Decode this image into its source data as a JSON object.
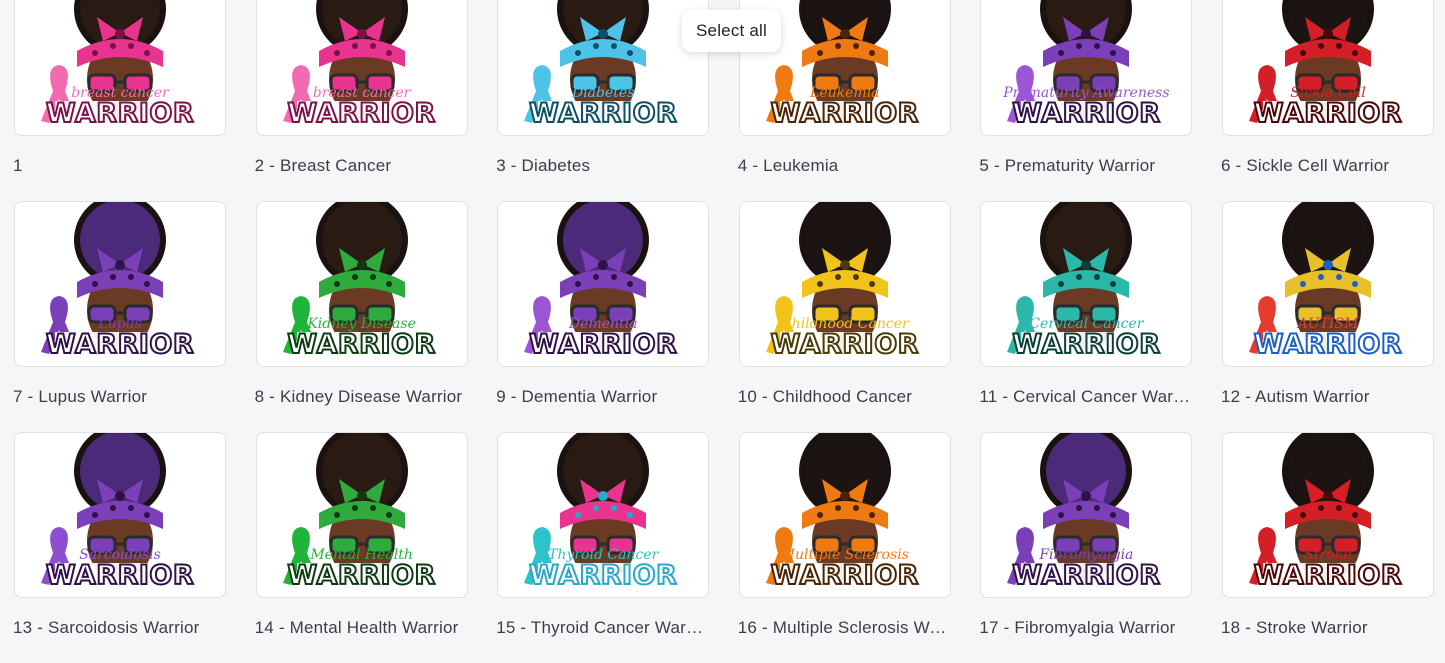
{
  "tooltip": {
    "label": "Select all"
  },
  "items": [
    {
      "caption": "1",
      "scarf": "#e8338f",
      "pattern": "#7a1147",
      "hair": "#2a1a14",
      "ribbon": "#f26bb0",
      "text": "breast cancer",
      "warrior": "WARRIOR",
      "glasses": "#2b2b2b"
    },
    {
      "caption": "2 - Breast Cancer",
      "scarf": "#e8338f",
      "pattern": "#7a1147",
      "hair": "#2a1a14",
      "ribbon": "#f26bb0",
      "text": "breast cancer",
      "warrior": "WARRIOR",
      "glasses": "#2b2b2b"
    },
    {
      "caption": "3 - Diabetes",
      "scarf": "#4ec3e8",
      "pattern": "#0d4f66",
      "hair": "#2a1a14",
      "ribbon": "#4ec3e8",
      "text": "Diabetes",
      "warrior": "WARRIOR",
      "glasses": "#2b2b2b"
    },
    {
      "caption": "4 - Leukemia",
      "scarf": "#f07a12",
      "pattern": "#4a2305",
      "hair": "#1b1412",
      "ribbon": "#f07a12",
      "text": "Leukemia",
      "warrior": "WARRIOR",
      "glasses": "#2b2b2b"
    },
    {
      "caption": "5 - Prematurity Warrior",
      "scarf": "#7b3fb8",
      "pattern": "#2e1145",
      "hair": "#2a1a14",
      "ribbon": "#9b55d6",
      "text": "Prematurity Awareness",
      "warrior": "WARRIOR",
      "glasses": "#2b2b2b"
    },
    {
      "caption": "6 - Sickle Cell Warrior",
      "scarf": "#d41f27",
      "pattern": "#4a0709",
      "hair": "#1b1412",
      "ribbon": "#d41f27",
      "text": "Sickle Cell",
      "warrior": "WARRIOR",
      "glasses": "#2b2b2b"
    },
    {
      "caption": "7 - Lupus Warrior",
      "scarf": "#7b3fb8",
      "pattern": "#2e1145",
      "hair": "#4b2a7a",
      "ribbon": "#7b3fb8",
      "text": "Lupus",
      "warrior": "WARRIOR",
      "glasses": "#2b2b2b"
    },
    {
      "caption": "8 - Kidney Disease Warrior",
      "scarf": "#2faa3c",
      "pattern": "#0d3a12",
      "hair": "#2a1a14",
      "ribbon": "#1fb53a",
      "text": "Kidney Disease",
      "warrior": "WARRIOR",
      "glasses": "#2b2b2b"
    },
    {
      "caption": "9 - Dementia Warrior",
      "scarf": "#7b3fb8",
      "pattern": "#2e1145",
      "hair": "#4b2a7a",
      "ribbon": "#9b55d6",
      "text": "Dementia",
      "warrior": "WARRIOR",
      "glasses": "#2b2b2b"
    },
    {
      "caption": "10 - Childhood Cancer",
      "scarf": "#f2c318",
      "pattern": "#4a3a05",
      "hair": "#1b1412",
      "ribbon": "#f2c318",
      "text": "Childhood Cancer",
      "warrior": "WARRIOR",
      "glasses": "#2b2b2b"
    },
    {
      "caption": "11 - Cervical Cancer Warrior",
      "scarf": "#2bb8a8",
      "pattern": "#0b3e38",
      "hair": "#2a1a14",
      "ribbon": "#2bb8a8",
      "text": "Cervical Cancer",
      "warrior": "WARRIOR",
      "glasses": "#2b2b2b"
    },
    {
      "caption": "12 - Autism Warrior",
      "scarf": "#e8c12a",
      "pattern": "#1d5fc4",
      "hair": "#1b1412",
      "ribbon": "#e63b2e",
      "text": "AUTISM",
      "warrior": "WARRIOR",
      "glasses": "#2b2b2b"
    },
    {
      "caption": "13 - Sarcoidosis Warrior",
      "scarf": "#7b3fb8",
      "pattern": "#2e1145",
      "hair": "#4b2a7a",
      "ribbon": "#8c4fd0",
      "text": "Sarcoidosis",
      "warrior": "WARRIOR",
      "glasses": "#2b2b2b"
    },
    {
      "caption": "14 - Mental Health Warrior",
      "scarf": "#2faa3c",
      "pattern": "#0d3a12",
      "hair": "#2a1a14",
      "ribbon": "#1fb53a",
      "text": "Mental Health",
      "warrior": "WARRIOR",
      "glasses": "#2b2b2b"
    },
    {
      "caption": "15 - Thyroid Cancer Warrior",
      "scarf": "#e8338f",
      "pattern": "#2aa7c9",
      "hair": "#2a1a14",
      "ribbon": "#2ac4c9",
      "text": "Thyroid Cancer",
      "warrior": "WARRIOR",
      "glasses": "#2b2b2b"
    },
    {
      "caption": "16 - Multiple Sclerosis Warrior",
      "scarf": "#f07a12",
      "pattern": "#4a2305",
      "hair": "#1b1412",
      "ribbon": "#f07a12",
      "text": "Multiple Sclerosis",
      "warrior": "WARRIOR",
      "glasses": "#2b2b2b"
    },
    {
      "caption": "17 - Fibromyalgia Warrior",
      "scarf": "#7b3fb8",
      "pattern": "#2e1145",
      "hair": "#4b2a7a",
      "ribbon": "#7b3fb8",
      "text": "Fibromyalgia",
      "warrior": "WARRIOR",
      "glasses": "#2b2b2b"
    },
    {
      "caption": "18 - Stroke Warrior",
      "scarf": "#d41f27",
      "pattern": "#4a0709",
      "hair": "#1b1412",
      "ribbon": "#d41f27",
      "text": "Stroke",
      "warrior": "WARRIOR",
      "glasses": "#2b2b2b"
    }
  ]
}
